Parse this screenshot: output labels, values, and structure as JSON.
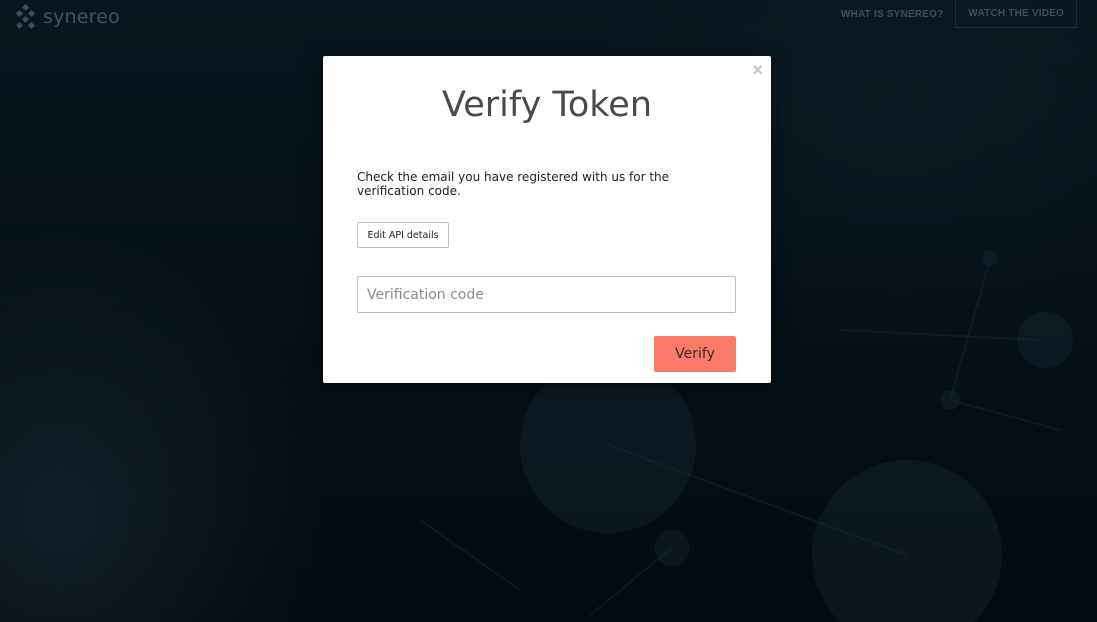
{
  "header": {
    "logo_text": "synereo",
    "nav": [
      {
        "label": "WHAT IS SYNEREO?"
      },
      {
        "label": "WATCH THE VIDEO"
      }
    ]
  },
  "modal": {
    "close_glyph": "×",
    "title": "Verify Token",
    "description": "Check the email you have registered with us for the verification code.",
    "edit_button_label": "Edit API details",
    "input": {
      "placeholder": "Verification code",
      "value": ""
    },
    "verify_button_label": "Verify"
  },
  "colors": {
    "accent": "#fa7a68",
    "background": "#0b1a24"
  },
  "icons": {
    "logo": "synereo-logo-icon",
    "close": "close-icon"
  }
}
